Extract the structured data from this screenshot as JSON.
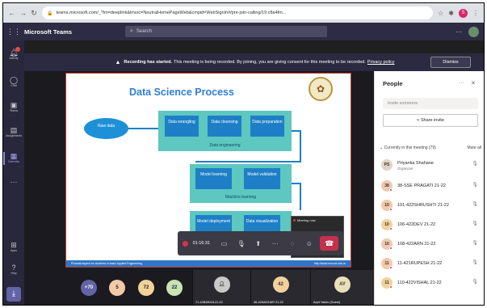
{
  "browser": {
    "url": "teams.microsoft.com/_?lm=deeplink&lmsrc=NeutralHomePageWeb&cmpid=WebSignIn#/pre-join-calling/19:c8a4fm...",
    "profile_initial": "S"
  },
  "teams": {
    "app_title": "Microsoft Teams",
    "search_placeholder": "Search"
  },
  "rail": [
    {
      "label": "Activity",
      "icon": "bell-icon"
    },
    {
      "label": "Chat",
      "icon": "chat-icon"
    },
    {
      "label": "Teams",
      "icon": "teams-icon"
    },
    {
      "label": "Assignments",
      "icon": "assignments-icon"
    },
    {
      "label": "Calendar",
      "icon": "calendar-icon"
    },
    {
      "label": "Apps",
      "icon": "apps-icon"
    },
    {
      "label": "Help",
      "icon": "help-icon"
    }
  ],
  "banner": {
    "bold": "Recording has started.",
    "text": "This meeting is being recorded. By joining, you are giving consent for this meeting to be recorded.",
    "link": "Privacy policy",
    "dismiss": "Dismiss"
  },
  "slide": {
    "title": "Data Science Process",
    "raw_data": "Raw data",
    "boxes": [
      "Data wrangling",
      "Data cleansing",
      "Data preparation",
      "Model learning",
      "Model validation",
      "Model deployment",
      "Data visualization"
    ],
    "bands": [
      "Data engineering",
      "Machine learning"
    ],
    "footer_left": "Pictorial aspect for students in basic Applied Engineering",
    "footer_right": "http://www.mmcoe.edu.in"
  },
  "controls": {
    "timer": "01:16:31"
  },
  "pip": {
    "label": "Meeting now"
  },
  "strip": {
    "bubbles": [
      "+70",
      "5",
      "72",
      "22"
    ],
    "tiles": [
      {
        "name": "71-42B48018-21-22",
        "avatar": ""
      },
      {
        "name": "46-42NAGHAR 21-22",
        "avatar": "42"
      },
      {
        "name": "Arpit Yadav (Guest)",
        "avatar": "AY"
      }
    ]
  },
  "people": {
    "title": "People",
    "invite_placeholder": "Invite someone",
    "share_invite": "Share invite",
    "section": "Currently in this meeting (79)",
    "mute_all": "Mute all",
    "list": [
      {
        "initials": "PS",
        "name": "Priyanka Shahane",
        "role": "Organizer",
        "color": "#e3d3c6"
      },
      {
        "initials": "38",
        "name": "38-SSE PRAGATI 21-22",
        "role": "",
        "color": "#f0c9b0"
      },
      {
        "initials": "10",
        "name": "101-422SHRUSHTI 21-22",
        "role": "",
        "color": "#f4c9a8"
      },
      {
        "initials": "10",
        "name": "106-422DEV 21-22",
        "role": "",
        "color": "#f2d29a"
      },
      {
        "initials": "10",
        "name": "108-422ARN 21-22",
        "role": "",
        "color": "#f0c9b0"
      },
      {
        "initials": "11",
        "name": "11-421RUPESH 21-22",
        "role": "",
        "color": "#f4c9a8"
      },
      {
        "initials": "11",
        "name": "110-422VISHAL 21-22",
        "role": "",
        "color": "#f2d29a"
      }
    ]
  }
}
